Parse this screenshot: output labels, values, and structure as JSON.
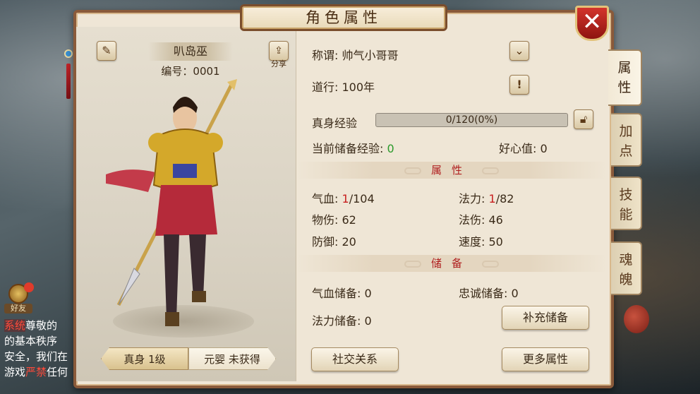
{
  "window": {
    "title": "角色属性",
    "close_label": "✕"
  },
  "character": {
    "name": "叭岛巫",
    "id_label": "编号：",
    "id": "0001",
    "share_label": "分享"
  },
  "tabs_bottom": [
    {
      "label": "真身 1级"
    },
    {
      "label": "元婴 未获得"
    }
  ],
  "info": {
    "title_label": "称谓:",
    "title_value": "帅气小哥哥",
    "dao_label": "道行:",
    "dao_value": "100年",
    "exp_label": "真身经验",
    "exp_text": "0/120(0%)",
    "exp_percent": 0,
    "stored_exp_label": "当前储备经验:",
    "stored_exp_value": "0",
    "kindness_label": "好心值:",
    "kindness_value": "0"
  },
  "attributes": {
    "header": "属性",
    "hp_label": "气血:",
    "hp_current": "1",
    "hp_max": "/104",
    "mp_label": "法力:",
    "mp_current": "1",
    "mp_max": "/82",
    "phys_label": "物伤:",
    "phys_value": "62",
    "magic_label": "法伤:",
    "magic_value": "46",
    "def_label": "防御:",
    "def_value": "20",
    "speed_label": "速度:",
    "speed_value": "50"
  },
  "reserve": {
    "header": "储备",
    "hp_label": "气血储备:",
    "hp_value": "0",
    "loyalty_label": "忠诚储备:",
    "loyalty_value": "0",
    "mp_label": "法力储备:",
    "mp_value": "0",
    "refill_button": "补充储备"
  },
  "buttons": {
    "social": "社交关系",
    "more": "更多属性"
  },
  "side_tabs": [
    {
      "label": "属性",
      "active": true
    },
    {
      "label": "加点",
      "active": false
    },
    {
      "label": "技能",
      "active": false
    },
    {
      "label": "魂魄",
      "active": false
    }
  ],
  "chat": {
    "friends_label": "好友",
    "line1_tag": "系统",
    "line1": "尊敬的",
    "line2": "的基本秩序",
    "line3": "安全，我们在",
    "line4_a": "游戏",
    "line4_red": "严禁",
    "line4_b": "任何"
  },
  "icons": {
    "edit": "pencil-icon",
    "share": "share-icon",
    "dropdown": "chevron-down-icon",
    "info": "exclamation-icon",
    "lock": "lock-icon",
    "close": "close-icon"
  },
  "colors": {
    "panel_border": "#8a5a3a",
    "panel_bg": "#efe6d6",
    "highlight_red": "#c81e1e",
    "value_green": "#2a9a2a",
    "close_red": "#c3242a"
  }
}
